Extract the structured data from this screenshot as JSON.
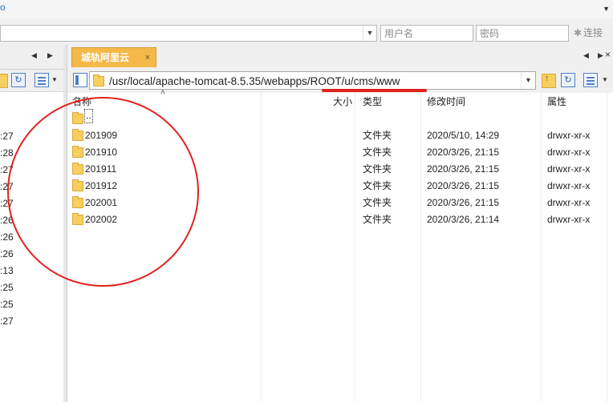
{
  "top": {
    "left_glyph": "ο",
    "right_glyph": "▼"
  },
  "connection": {
    "user_placeholder": "用户名",
    "password_placeholder": "密码",
    "connect_label": "连接",
    "connect_icon": "plug-icon"
  },
  "left_pane": {
    "nav_prev": "◀",
    "nav_next": "▶",
    "times": [
      ":27",
      ":28",
      ":27",
      ":27",
      ":27",
      ":26",
      ":26",
      ":26",
      ":13",
      ":25",
      ":25",
      ":27"
    ]
  },
  "right_pane": {
    "tab_label": "城轨阿里云",
    "tab_close": "×",
    "nav_prev": "◀",
    "nav_next": "▶",
    "nav_close": "×",
    "path": "/usr/local/apache-tomcat-8.5.35/webapps/ROOT/u/cms/www",
    "columns": {
      "name": "名称",
      "size": "大小",
      "type": "类型",
      "modified": "修改时间",
      "attrs": "属性"
    },
    "parent_entry": "..",
    "files": [
      {
        "name": "201909",
        "type": "文件夹",
        "modified": "2020/5/10, 14:29",
        "attrs": "drwxr-xr-x"
      },
      {
        "name": "201910",
        "type": "文件夹",
        "modified": "2020/3/26, 21:15",
        "attrs": "drwxr-xr-x"
      },
      {
        "name": "201911",
        "type": "文件夹",
        "modified": "2020/3/26, 21:15",
        "attrs": "drwxr-xr-x"
      },
      {
        "name": "201912",
        "type": "文件夹",
        "modified": "2020/3/26, 21:15",
        "attrs": "drwxr-xr-x"
      },
      {
        "name": "202001",
        "type": "文件夹",
        "modified": "2020/3/26, 21:15",
        "attrs": "drwxr-xr-x"
      },
      {
        "name": "202002",
        "type": "文件夹",
        "modified": "2020/3/26, 21:14",
        "attrs": "drwxr-xr-x"
      }
    ]
  },
  "colors": {
    "accent_tab": "#f5b94a",
    "annotation_red": "#e0221e",
    "folder_yellow": "#f6cf60"
  }
}
